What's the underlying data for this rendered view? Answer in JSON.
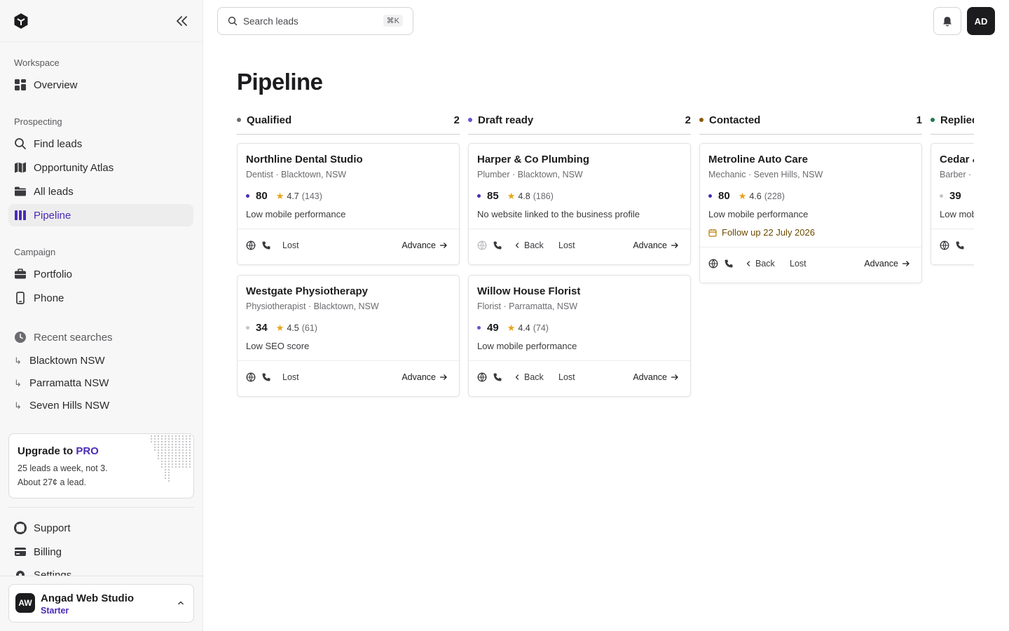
{
  "search": {
    "placeholder": "Search leads",
    "shortcut": "⌘K"
  },
  "user": {
    "initials": "AD"
  },
  "page": {
    "title": "Pipeline"
  },
  "sidebar": {
    "sections": {
      "workspace": "Workspace",
      "prospecting": "Prospecting",
      "campaign": "Campaign",
      "recent": "Recent searches"
    },
    "items": {
      "overview": "Overview",
      "find_leads": "Find leads",
      "atlas": "Opportunity Atlas",
      "all_leads": "All leads",
      "pipeline": "Pipeline",
      "portfolio": "Portfolio",
      "phone": "Phone",
      "support": "Support",
      "billing": "Billing",
      "settings": "Settings"
    },
    "recent_searches": [
      "Blacktown NSW",
      "Parramatta NSW",
      "Seven Hills NSW"
    ],
    "upgrade": {
      "title": "Upgrade to ",
      "pro": "PRO",
      "line1": "25 leads a week, not 3.",
      "line2": "About 27¢ a lead."
    },
    "account": {
      "initials": "AW",
      "name": "Angad Web Studio",
      "plan": "Starter"
    }
  },
  "colors": {
    "accent": "#4b2bb8",
    "star": "#e8a418",
    "follow_up": "#6b4a00"
  },
  "actions": {
    "back": "Back",
    "lost": "Lost",
    "advance": "Advance"
  },
  "columns": [
    {
      "name": "Qualified",
      "count": "2",
      "dot": "#6b6b70",
      "cards": [
        {
          "title": "Northline Dental Studio",
          "subtitle": "Dentist · Blacktown, NSW",
          "score": "80",
          "score_color": "#4b2bb8",
          "rating": "4.7",
          "reviews": "(143)",
          "note": "Low mobile performance",
          "has_back": false,
          "web_active": true
        },
        {
          "title": "Westgate Physiotherapy",
          "subtitle": "Physiotherapist · Blacktown, NSW",
          "score": "34",
          "score_color": "#c4c4c8",
          "rating": "4.5",
          "reviews": "(61)",
          "note": "Low SEO score",
          "has_back": false,
          "web_active": true
        }
      ]
    },
    {
      "name": "Draft ready",
      "count": "2",
      "dot": "#6d4fd1",
      "cards": [
        {
          "title": "Harper & Co Plumbing",
          "subtitle": "Plumber · Blacktown, NSW",
          "score": "85",
          "score_color": "#4b2bb8",
          "rating": "4.8",
          "reviews": "(186)",
          "note": "No website linked to the business profile",
          "has_back": true,
          "web_active": false
        },
        {
          "title": "Willow House Florist",
          "subtitle": "Florist · Parramatta, NSW",
          "score": "49",
          "score_color": "#6d4fd1",
          "rating": "4.4",
          "reviews": "(74)",
          "note": "Low mobile performance",
          "has_back": true,
          "web_active": true
        }
      ]
    },
    {
      "name": "Contacted",
      "count": "1",
      "dot": "#8a5a00",
      "cards": [
        {
          "title": "Metroline Auto Care",
          "subtitle": "Mechanic · Seven Hills, NSW",
          "score": "80",
          "score_color": "#4b2bb8",
          "rating": "4.6",
          "reviews": "(228)",
          "note": "Low mobile performance",
          "follow_up": "Follow up 22 July 2026",
          "has_back": true,
          "web_active": true
        }
      ]
    },
    {
      "name": "Replied",
      "count": "",
      "dot": "#1d7a4a",
      "cards": [
        {
          "title": "Cedar & Co",
          "subtitle": "Barber · Blacktown, NSW",
          "score": "39",
          "score_color": "#c4c4c8",
          "rating": "",
          "reviews": "",
          "note": "Low mobile performance",
          "has_back": true,
          "web_active": true
        }
      ]
    }
  ]
}
